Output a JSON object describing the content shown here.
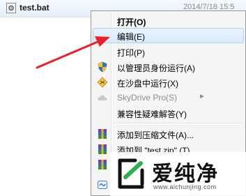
{
  "file": {
    "name": "test.bat",
    "date": "2014/7/18 15:5"
  },
  "context_menu": {
    "items": [
      {
        "label": "打开(O)",
        "style": "bold"
      },
      {
        "label": "编辑(E)",
        "state": "highlighted"
      },
      {
        "label": "打印(P)"
      },
      {
        "label": "以管理员身份运行(A)",
        "icon": "uac-shield-icon"
      },
      {
        "label": "在沙盘中运行(X)",
        "icon": "sandbox-icon"
      },
      {
        "label": "SkyDrive Pro(S)",
        "icon": "skydrive-cloud-icon",
        "state": "disabled",
        "has_submenu": true
      },
      {
        "label": "兼容性疑难解答(Y)"
      },
      {
        "label": "添加到压缩文件(A)...",
        "icon": "winrar-archive-icon"
      },
      {
        "label": "添加到 \"test.zip\" (T)",
        "icon": "winrar-archive-icon"
      }
    ]
  },
  "annotation": {
    "arrow_color": "#e8212c"
  },
  "watermark": {
    "name": "爱纯净",
    "url": "www.aichunjing.com"
  }
}
